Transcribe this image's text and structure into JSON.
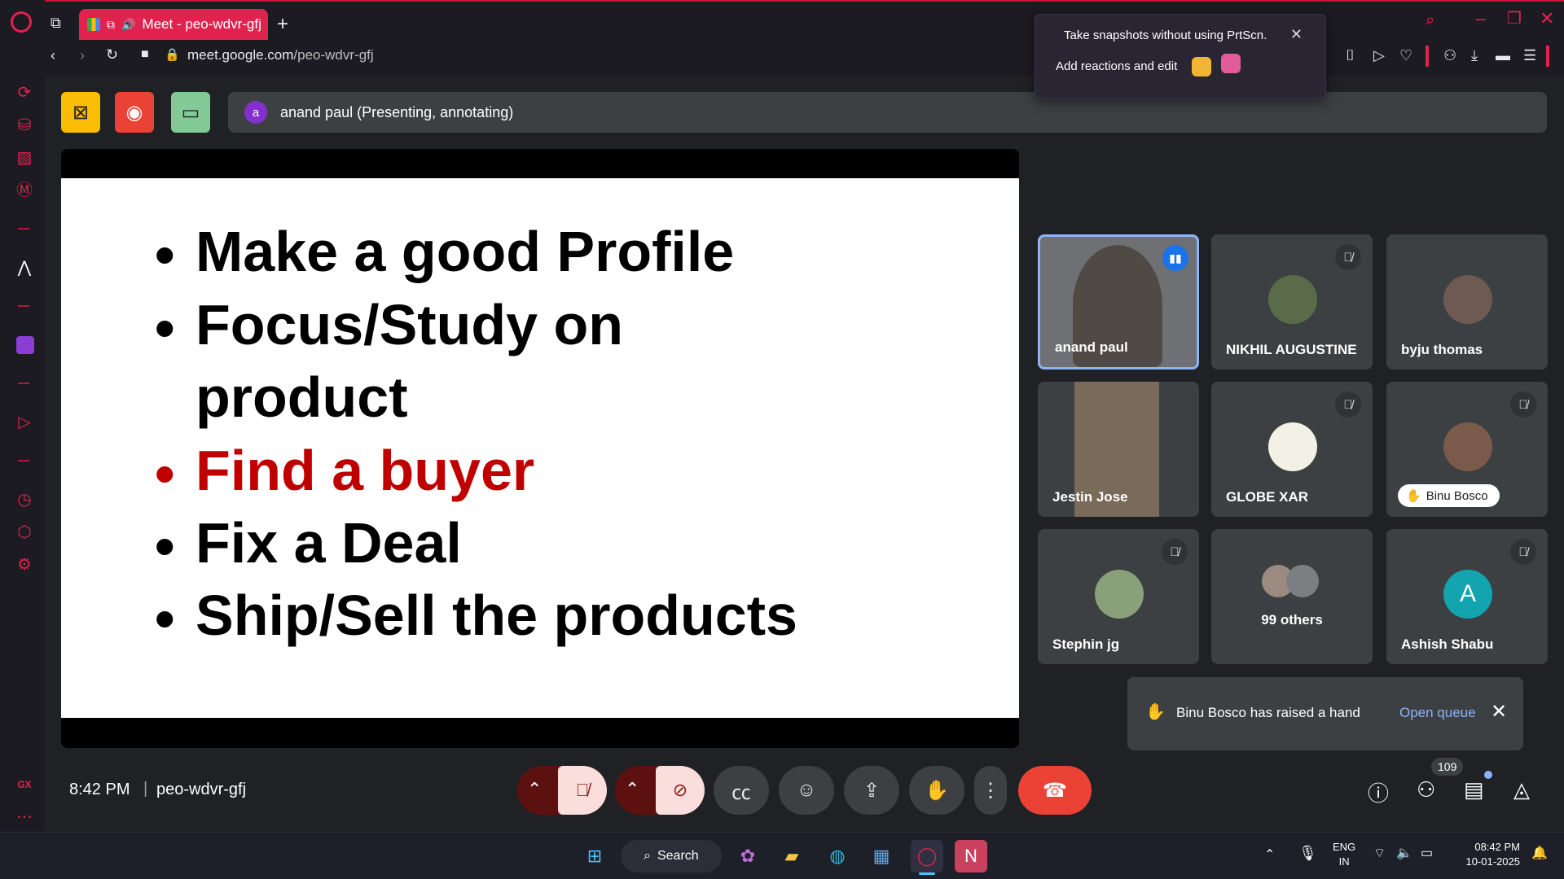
{
  "browser": {
    "tab_title": "Meet - peo-wdvr-gfj",
    "url_host": "meet.google.com",
    "url_path": "/peo-wdvr-gfj",
    "new_tab": "+"
  },
  "popup": {
    "line1": "Take snapshots without using PrtScn.",
    "line2": "Add reactions and edit"
  },
  "presenter": {
    "avatar_letter": "a",
    "label": "anand paul (Presenting, annotating)"
  },
  "slide": {
    "bullets": [
      {
        "text": "Make a good Profile",
        "highlight": false
      },
      {
        "text": "Focus/Study on",
        "highlight": false
      },
      {
        "text": "product",
        "highlight": false
      },
      {
        "text": "Find a buyer",
        "highlight": true
      },
      {
        "text": "Fix a Deal",
        "highlight": false
      },
      {
        "text": "Ship/Sell the products",
        "highlight": false
      }
    ],
    "highlight_color": "#c00000"
  },
  "participants": [
    {
      "name": "anand paul",
      "speaking": true,
      "muted": false
    },
    {
      "name": "NIKHIL AUGUSTINE",
      "muted": true
    },
    {
      "name": "byju thomas",
      "muted": false
    },
    {
      "name": "Jestin Jose",
      "muted": false
    },
    {
      "name": "GLOBE XAR",
      "muted": true
    },
    {
      "name": "Binu Bosco",
      "muted": true,
      "hand_raised": true
    },
    {
      "name": "Stephin jg",
      "muted": true
    },
    {
      "name": "99 others"
    },
    {
      "name": "Ashish Shabu",
      "muted": true,
      "avatar_letter": "A"
    }
  ],
  "notification": {
    "text": "Binu Bosco has raised a hand",
    "action": "Open queue"
  },
  "footer": {
    "time": "8:42 PM",
    "separator": "|",
    "meeting_code": "peo-wdvr-gfj",
    "people_count": "109"
  },
  "taskbar": {
    "search": "Search",
    "lang1": "ENG",
    "lang2": "IN",
    "time": "08:42 PM",
    "date": "10-01-2025"
  },
  "colors": {
    "accent": "#e0234e",
    "meet_bg": "#202124",
    "tile_bg": "#3c4043",
    "end_call": "#ea4335"
  }
}
